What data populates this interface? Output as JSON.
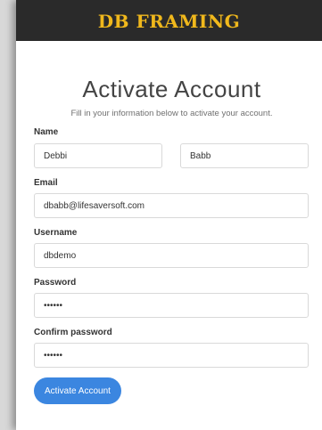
{
  "header": {
    "brand": "DB FRAMING"
  },
  "form": {
    "title": "Activate Account",
    "subtitle": "Fill in your information below to activate your account.",
    "name_label": "Name",
    "first_name_value": "Debbi",
    "last_name_value": "Babb",
    "email_label": "Email",
    "email_value": "dbabb@lifesaversoft.com",
    "username_label": "Username",
    "username_value": "dbdemo",
    "password_label": "Password",
    "password_value": "••••••",
    "confirm_password_label": "Confirm password",
    "confirm_password_value": "••••••",
    "submit_label": "Activate Account"
  },
  "colors": {
    "brand_bar": "#2a2a2a",
    "brand_text": "#f0b81c",
    "button": "#3b86e0"
  }
}
